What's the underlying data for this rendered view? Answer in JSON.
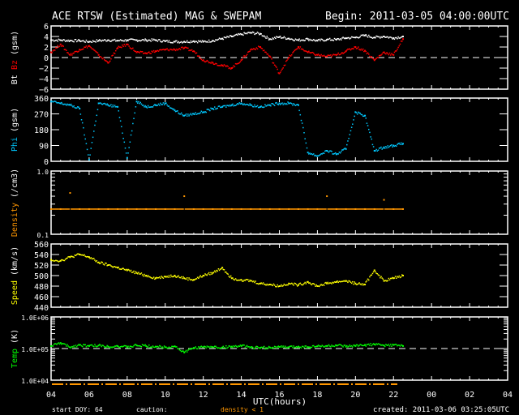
{
  "header": {
    "title": "ACE RTSW (Estimated) MAG & SWEPAM",
    "begin": "Begin: 2011-03-05 04:00:00UTC"
  },
  "footer": {
    "start_doy": "start DOY:  64",
    "caution": "caution:",
    "density_flag": "density < 1",
    "created": "created: 2011-03-06 03:25:05UTC",
    "xlabel": "UTC(hours)"
  },
  "colors": {
    "bt": "#ffffff",
    "bz": "#ff0000",
    "phi": "#00c8ff",
    "density": "#ff9600",
    "speed": "#ffff00",
    "temp": "#00ff00"
  },
  "chart_data": [
    {
      "type": "scatter",
      "ylabel_parts": [
        "Bt",
        "Bz",
        "(gsm)"
      ],
      "ylim": [
        -6,
        6
      ],
      "yticks": [
        6,
        4,
        2,
        0,
        -2,
        -4,
        -6
      ],
      "ytick_labels": [
        "6",
        "4",
        "2",
        "0",
        "−2",
        "−4",
        "−6"
      ],
      "reference_line": 0,
      "series": [
        {
          "name": "Bt",
          "color": "#ffffff",
          "values": [
            3.3,
            3.3,
            3.2,
            3.2,
            3.0,
            3.2,
            3.3,
            3.2,
            3.3,
            3.3,
            3.3,
            3.3,
            3.1,
            3.0,
            3.0,
            3.1,
            3.0,
            3.2,
            3.6,
            4.0,
            4.4,
            4.7,
            4.5,
            3.5,
            3.9,
            3.6,
            3.3,
            3.5,
            3.2,
            3.4,
            3.4,
            3.7,
            3.8,
            4.2,
            3.8,
            4.0,
            3.7,
            4.0
          ]
        },
        {
          "name": "Bz",
          "color": "#ff0000",
          "values": [
            1.0,
            2.5,
            0.5,
            1.5,
            2.2,
            0.5,
            -1.0,
            1.8,
            2.5,
            1.0,
            0.8,
            1.2,
            1.5,
            1.5,
            1.8,
            1.2,
            -0.5,
            -1.0,
            -1.5,
            -2.0,
            -0.5,
            1.5,
            2.0,
            0.2,
            -3.0,
            0.0,
            2.0,
            1.0,
            0.5,
            0.2,
            0.5,
            1.2,
            2.0,
            1.3,
            -0.5,
            1.0,
            0.5,
            3.5
          ]
        }
      ],
      "x_start_hour": 4,
      "x_step_hours": 0.5
    },
    {
      "type": "scatter",
      "ylabel_parts": [
        "Phi",
        "(gsm)"
      ],
      "ylim": [
        0,
        360
      ],
      "yticks": [
        360,
        270,
        180,
        90,
        0
      ],
      "ytick_labels": [
        "360",
        "270",
        "180",
        "90",
        "0"
      ],
      "series": [
        {
          "name": "Phi",
          "color": "#00c8ff",
          "values": [
            340,
            330,
            320,
            300,
            10,
            330,
            320,
            310,
            20,
            340,
            310,
            320,
            330,
            290,
            260,
            270,
            280,
            300,
            310,
            320,
            330,
            320,
            310,
            320,
            330,
            330,
            320,
            50,
            30,
            60,
            40,
            70,
            280,
            260,
            60,
            80,
            90,
            100
          ]
        }
      ],
      "x_start_hour": 4,
      "x_step_hours": 0.5
    },
    {
      "type": "scatter",
      "ylabel_parts": [
        "Density",
        "(/cm3)"
      ],
      "yscale": "log",
      "ylim": [
        0.1,
        1.0
      ],
      "ytick_labels": [
        "1.0",
        "0.1"
      ],
      "series": [
        {
          "name": "Density",
          "color": "#ff9600",
          "values": [
            0.25,
            0.25,
            0.45,
            0.25,
            0.25,
            0.25,
            0.25,
            0.25,
            0.25,
            0.25,
            0.25,
            0.25,
            0.25,
            0.25,
            0.4,
            0.25,
            0.25,
            0.25,
            0.25,
            0.25,
            0.25,
            0.25,
            0.25,
            0.25,
            0.25,
            0.25,
            0.25,
            0.25,
            0.25,
            0.4,
            0.25,
            0.25,
            0.25,
            0.25,
            0.25,
            0.35,
            0.25,
            0.25
          ]
        }
      ],
      "x_start_hour": 4,
      "x_step_hours": 0.5
    },
    {
      "type": "scatter",
      "ylabel_parts": [
        "Speed",
        "(km/s)"
      ],
      "ylim": [
        440,
        560
      ],
      "yticks": [
        560,
        540,
        520,
        500,
        480,
        460,
        440
      ],
      "ytick_labels": [
        "560",
        "540",
        "520",
        "500",
        "480",
        "460",
        "440"
      ],
      "series": [
        {
          "name": "Speed",
          "color": "#ffff00",
          "values": [
            530,
            528,
            535,
            540,
            535,
            525,
            520,
            515,
            510,
            505,
            500,
            495,
            498,
            500,
            495,
            492,
            500,
            505,
            515,
            495,
            492,
            490,
            485,
            483,
            480,
            485,
            482,
            488,
            480,
            485,
            488,
            490,
            485,
            483,
            510,
            490,
            495,
            500
          ]
        }
      ],
      "x_start_hour": 4,
      "x_step_hours": 0.5
    },
    {
      "type": "scatter",
      "ylabel_parts": [
        "Temp",
        "(K)"
      ],
      "yscale": "log",
      "ylim": [
        10000,
        1000000
      ],
      "ytick_labels": [
        "1.0E+06",
        "1.0E+05",
        "1.0E+04"
      ],
      "reference_line": 100000,
      "series": [
        {
          "name": "Temp",
          "color": "#00ff00",
          "values": [
            120000,
            150000,
            110000,
            130000,
            120000,
            125000,
            115000,
            120000,
            110000,
            125000,
            120000,
            115000,
            110000,
            118000,
            75000,
            105000,
            110000,
            112000,
            108000,
            115000,
            120000,
            110000,
            105000,
            108000,
            112000,
            110000,
            115000,
            112000,
            118000,
            120000,
            125000,
            115000,
            120000,
            130000,
            135000,
            125000,
            130000,
            120000
          ]
        }
      ],
      "x_start_hour": 4,
      "x_step_hours": 0.5
    }
  ],
  "xaxis": {
    "tick_labels": [
      "04",
      "06",
      "08",
      "10",
      "12",
      "14",
      "16",
      "18",
      "20",
      "22",
      "00",
      "02",
      "04"
    ],
    "range_hours": [
      4,
      28
    ]
  }
}
